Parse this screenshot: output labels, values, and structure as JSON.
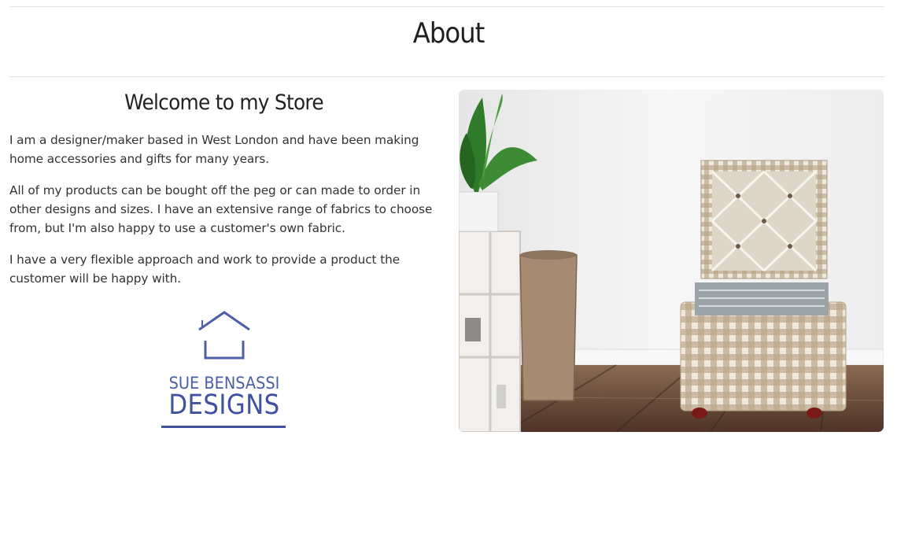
{
  "page": {
    "title": "About"
  },
  "intro": {
    "heading": "Welcome to my Store",
    "paragraphs": [
      "I am a designer/maker based in West London and have been making home accessories and gifts for many years.",
      "All of my products can be bought off the peg or can made to order in other designs and sizes. I have an extensive range of fabrics to choose from, but I'm also happy to use a customer's own fabric.",
      "I have a very flexible approach and work to provide a product the customer will be happy with."
    ]
  },
  "logo": {
    "line1": "SUE BENSASSI",
    "line2": "DESIGNS",
    "icon": "house-outline-icon",
    "color": "#3f51a0"
  },
  "photo": {
    "subject": "gingham-storage-ottoman-photo",
    "colors": {
      "wall": "#f2f2f2",
      "floor": "#6b4a36",
      "fabric": "#b59e80"
    }
  }
}
